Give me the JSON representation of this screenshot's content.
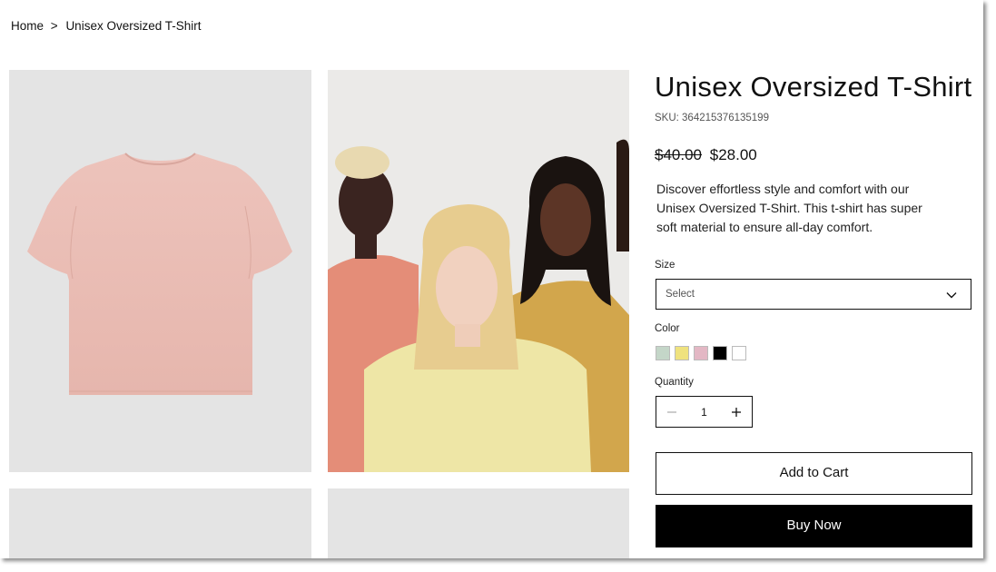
{
  "breadcrumb": {
    "home": "Home",
    "separator": ">",
    "current": "Unisex Oversized T-Shirt"
  },
  "product": {
    "title": "Unisex Oversized T-Shirt",
    "sku": "SKU: 364215376135199",
    "price_original": "$40.00",
    "price_sale": "$28.00",
    "description": "Discover effortless style and comfort with our Unisex Oversized T-Shirt. This t-shirt has super soft material to ensure all-day comfort."
  },
  "size": {
    "label": "Size",
    "placeholder": "Select"
  },
  "color": {
    "label": "Color",
    "swatches": [
      {
        "name": "sage",
        "hex": "#c4d6c8"
      },
      {
        "name": "yellow",
        "hex": "#efe27e"
      },
      {
        "name": "pink",
        "hex": "#e3b7c4"
      },
      {
        "name": "black",
        "hex": "#000000"
      },
      {
        "name": "white",
        "hex": "#ffffff"
      }
    ]
  },
  "quantity": {
    "label": "Quantity",
    "value": "1"
  },
  "actions": {
    "add_to_cart": "Add to Cart",
    "buy_now": "Buy Now"
  },
  "colors": {
    "tshirt_pink": "#e9bdb5",
    "tile_bg": "#e4e4e4"
  }
}
